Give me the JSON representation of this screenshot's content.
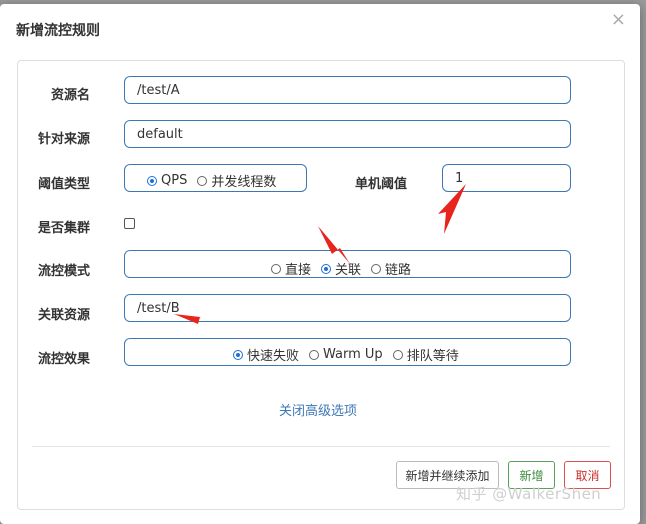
{
  "dialog": {
    "title": "新增流控规则",
    "close_glyph": "×"
  },
  "form": {
    "resource_name_label": "资源名",
    "resource_name_value": "/test/A",
    "source_label": "针对来源",
    "source_value": "default",
    "threshold_type_label": "阈值类型",
    "threshold_type_options": [
      "QPS",
      "并发线程数"
    ],
    "threshold_type_selected": "QPS",
    "single_threshold_label": "单机阈值",
    "single_threshold_value": "1",
    "cluster_label": "是否集群",
    "cluster_checked": false,
    "flow_mode_label": "流控模式",
    "flow_mode_options": [
      "直接",
      "关联",
      "链路"
    ],
    "flow_mode_selected": "关联",
    "related_resource_label": "关联资源",
    "related_resource_value": "/test/B",
    "flow_effect_label": "流控效果",
    "flow_effect_options": [
      "快速失败",
      "Warm Up",
      "排队等待"
    ],
    "flow_effect_selected": "快速失败",
    "advanced_link": "关闭高级选项"
  },
  "footer": {
    "add_continue_label": "新增并继续添加",
    "add_label": "新增",
    "cancel_label": "取消"
  },
  "watermark": "知乎 @WalkerShen",
  "colors": {
    "accent": "#3c78b4",
    "radio": "#1e6fd9",
    "annotation_arrow": "#e8251c",
    "success": "#3c8c3c",
    "danger": "#c9302c"
  }
}
